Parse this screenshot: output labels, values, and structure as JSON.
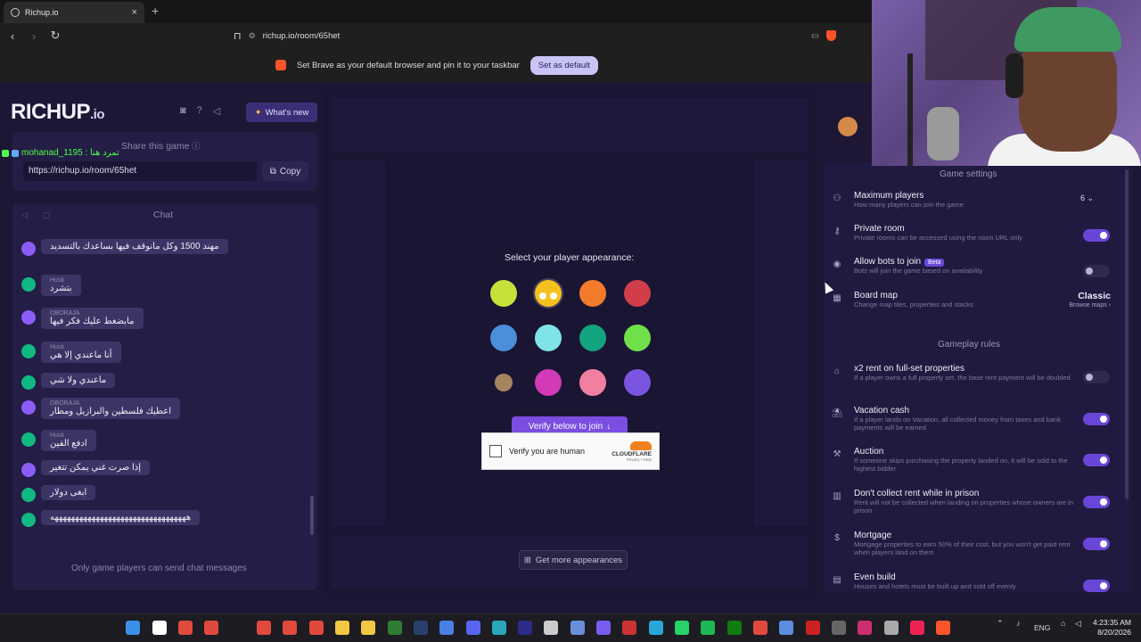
{
  "browser": {
    "tab_title": "Richup.io",
    "tab_close": "×",
    "new_tab": "+",
    "url": "richup.io/room/65het",
    "banner_text": "Set Brave as your default browser and pin it to your taskbar",
    "banner_button": "Set as default"
  },
  "app": {
    "logo_main": "RICHUP",
    "logo_suffix": ".io",
    "whats_new": "What's new",
    "share_title": "Share this game",
    "share_url": "https://richup.io/room/65het",
    "copy_label": "Copy",
    "chat_title": "Chat",
    "chat_footer": "Only game players can send chat messages",
    "overlay_username": "mohanad_1195 : تمرد هنا"
  },
  "chat": {
    "messages": [
      {
        "name": "",
        "text": "مهند 1500 وكل مانوقف فيها بساعدك بالتسديد",
        "color": "#8b5cf6"
      },
      {
        "name": "Husk",
        "text": "بتشرد",
        "color": "#10b981"
      },
      {
        "name": "OBORAJA",
        "text": "مابضغط عليك فكر فيها",
        "color": "#8b5cf6"
      },
      {
        "name": "Husk",
        "text": "أنا ماعندي إلا هي",
        "color": "#10b981"
      },
      {
        "name": "",
        "text": "ماعندي ولا شي",
        "color": "#10b981"
      },
      {
        "name": "OBORAJA",
        "text": "اعطيك فلسطين والبرازيل ومطار",
        "color": "#8b5cf6"
      },
      {
        "name": "Husk",
        "text": "ادفع الفين",
        "color": "#10b981"
      },
      {
        "name": "",
        "text": "إذا صرت غني يمكن تتغير",
        "color": "#8b5cf6"
      },
      {
        "name": "",
        "text": "ابغى دولار",
        "color": "#10b981"
      },
      {
        "name": "",
        "text": "هههههههههههههههههههههههههههههههههه",
        "color": "#10b981"
      }
    ]
  },
  "appearance": {
    "title": "Select your player appearance:",
    "colors": [
      "#c5e13a",
      "#f5c21d",
      "#f27a2b",
      "#d13e4a",
      "#4a8fd8",
      "#7fe3e8",
      "#12a37f",
      "#6fe04a",
      "#a6845f",
      "#d23ab8",
      "#f07fa0",
      "#7b55e0"
    ],
    "verify_button": "Verify below to join",
    "captcha_label": "Verify you are human",
    "captcha_brand": "CLOUDFLARE",
    "captcha_links": "Privacy • Help",
    "more_appearances": "Get more appearances"
  },
  "settings": {
    "section_game": "Game settings",
    "section_rules": "Gameplay rules",
    "max_players_value": "6",
    "board_map_value": "Classic",
    "browse_maps": "Browse maps ›",
    "beta": "Beta",
    "rows": [
      {
        "label": "Maximum players",
        "desc": "How many players can join the game",
        "icon": "players-icon"
      },
      {
        "label": "Private room",
        "desc": "Private rooms can be accessed using the room URL only",
        "icon": "key-icon",
        "on": true
      },
      {
        "label": "Allow bots to join",
        "desc": "Bots will join the game based on availability",
        "icon": "bot-icon",
        "on": false
      },
      {
        "label": "Board map",
        "desc": "Change map tiles, properties and stacks",
        "icon": "map-icon"
      },
      {
        "label": "x2 rent on full-set properties",
        "desc": "If a player owns a full property set, the base rent payment will be doubled",
        "icon": "house-icon",
        "on": false
      },
      {
        "label": "Vacation cash",
        "desc": "If a player lands on Vacation, all collected money from taxes and bank payments will be earned",
        "icon": "beach-icon",
        "on": true
      },
      {
        "label": "Auction",
        "desc": "If someone skips purchasing the property landed on, it will be sold to the highest bidder",
        "icon": "gavel-icon",
        "on": true
      },
      {
        "label": "Don't collect rent while in prison",
        "desc": "Rent will not be collected when landing on properties whose owners are in prison",
        "icon": "prison-icon",
        "on": true
      },
      {
        "label": "Mortgage",
        "desc": "Mortgage properties to earn 50% of their cost, but you won't get paid rent when players land on them",
        "icon": "mortgage-icon",
        "on": true
      },
      {
        "label": "Even build",
        "desc": "Houses and hotels must be built up and sold off evenly",
        "icon": "build-icon",
        "on": true
      }
    ]
  },
  "taskbar": {
    "lang": "ENG",
    "time": "4:23:35 AM",
    "date": "8/20/2026"
  }
}
